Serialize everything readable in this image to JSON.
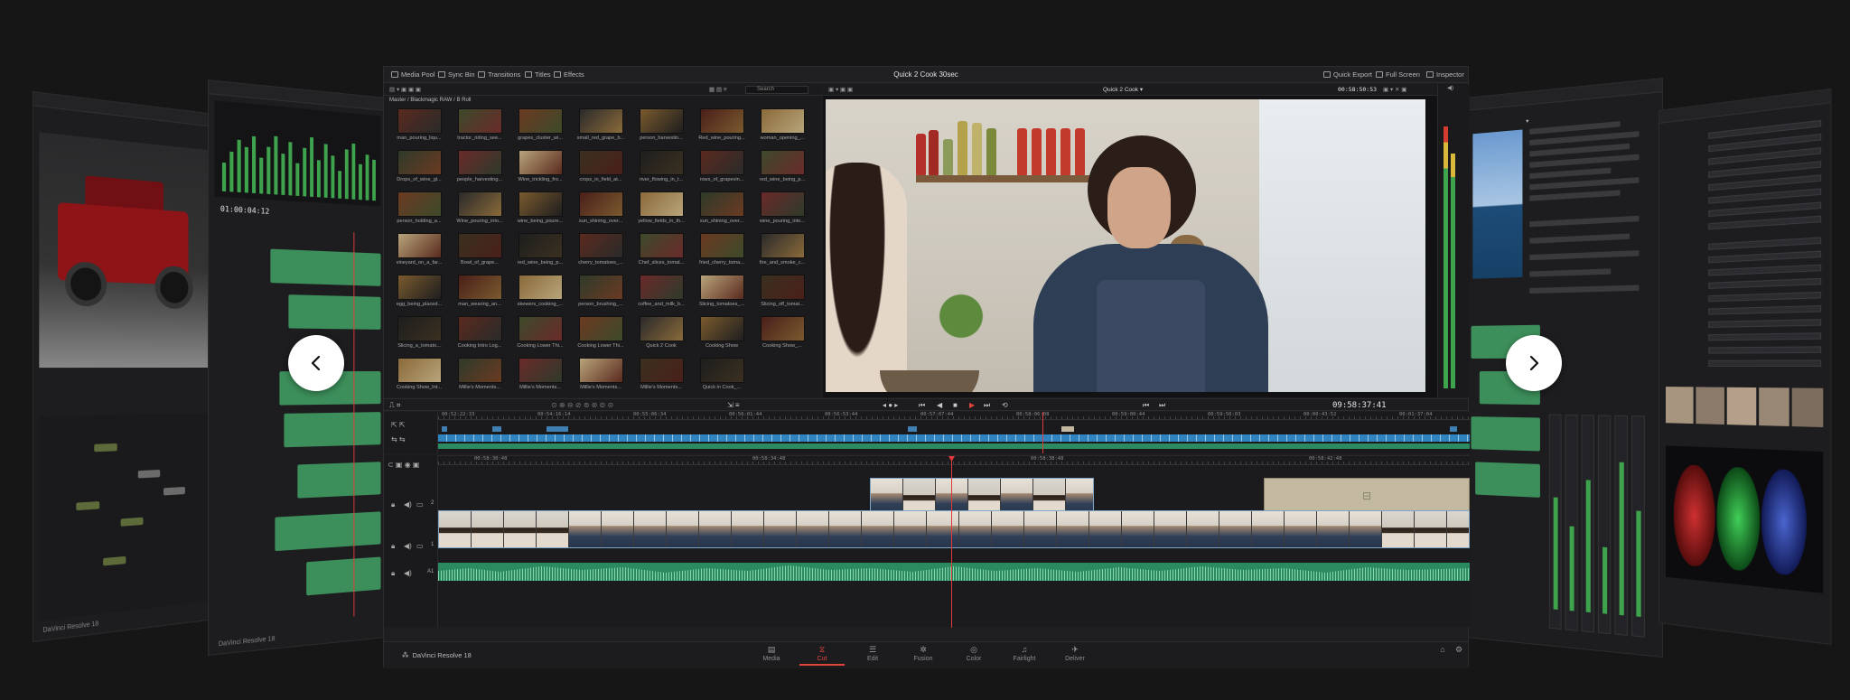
{
  "topbar": {
    "media_pool": "Media Pool",
    "sync_bin": "Sync Bin",
    "transitions": "Transitions",
    "titles": "Titles",
    "effects": "Effects",
    "window_title": "Quick 2 Cook 30sec",
    "quick_export": "Quick Export",
    "full_screen": "Full Screen",
    "inspector": "Inspector"
  },
  "media_pool": {
    "path": "Master / Blackmagic RAW / B Roll",
    "search_placeholder": "Search",
    "clips": [
      {
        "name": "man_pouring_liqu..."
      },
      {
        "name": "tractor_riding_see..."
      },
      {
        "name": "grapes_cluster_wi..."
      },
      {
        "name": "small_red_grape_b..."
      },
      {
        "name": "person_harvestin..."
      },
      {
        "name": "Red_wine_pouring..."
      },
      {
        "name": "woman_opening_..."
      },
      {
        "name": "Drops_of_wine_gl..."
      },
      {
        "name": "people_harvesting..."
      },
      {
        "name": "Wine_trickling_fro..."
      },
      {
        "name": "crops_in_field_at..."
      },
      {
        "name": "river_flowing_in_t..."
      },
      {
        "name": "rows_of_grapevin..."
      },
      {
        "name": "red_wine_being_p..."
      },
      {
        "name": "person_holding_a..."
      },
      {
        "name": "Wine_pouring_into..."
      },
      {
        "name": "wine_being_poure..."
      },
      {
        "name": "sun_shining_over..."
      },
      {
        "name": "yellow_fields_in_th..."
      },
      {
        "name": "sun_shining_over..."
      },
      {
        "name": "wine_pouring_into..."
      },
      {
        "name": "vineyard_on_a_far..."
      },
      {
        "name": "Bowl_of_grape..."
      },
      {
        "name": "red_wine_being_p..."
      },
      {
        "name": "cherry_tomatoes_..."
      },
      {
        "name": "Chef_slices_tomat..."
      },
      {
        "name": "fried_cherry_toma..."
      },
      {
        "name": "fire_and_smoke_c..."
      },
      {
        "name": "egg_being_placed..."
      },
      {
        "name": "man_wearing_an..."
      },
      {
        "name": "skewers_cooking_..."
      },
      {
        "name": "person_brushing_..."
      },
      {
        "name": "coffee_and_milk_b..."
      },
      {
        "name": "Slicing_tomatoes_..."
      },
      {
        "name": "Slicing_off_tomat..."
      },
      {
        "name": "Slicing_a_tomato..."
      },
      {
        "name": "Cooking Intro Log..."
      },
      {
        "name": "Cooking Lower Thi..."
      },
      {
        "name": "Cooking Lower Thi..."
      },
      {
        "name": "Quick 2 Cook"
      },
      {
        "name": "Cooking Show"
      },
      {
        "name": "Cooking Show_..."
      },
      {
        "name": "Cooking Show_Int..."
      },
      {
        "name": "Millie's Moments..."
      },
      {
        "name": "Millie's Moments..."
      },
      {
        "name": "Millie's Moments..."
      },
      {
        "name": "Millie's Moments..."
      },
      {
        "name": "Quick in Cook_..."
      }
    ]
  },
  "viewer": {
    "timeline_name": "Quick 2 Cook",
    "source_timecode": "00:58:50:53",
    "record_timecode": "09:58:37:41"
  },
  "upper_timeline": {
    "ruler": [
      "00:52:22:33",
      "00:54:16:14",
      "00:55:06:34",
      "00:56:01:44",
      "00:56:53:44",
      "00:57:07:44",
      "00:58:06:08",
      "00:59:00:44",
      "00:59:50:03",
      "00:00:43:52",
      "00:01:37:04"
    ]
  },
  "lower_timeline": {
    "ruler": [
      "00:58:30:48",
      "00:58:34:48",
      "00:58:38:48",
      "00:58:42:48"
    ],
    "track_v2": "2",
    "track_v1": "1",
    "track_a1": "A1"
  },
  "bottom_nav": {
    "brand": "DaVinci Resolve 18",
    "items": [
      {
        "label": "Media",
        "icon": "media-icon"
      },
      {
        "label": "Cut",
        "icon": "cut-icon",
        "active": true
      },
      {
        "label": "Edit",
        "icon": "edit-icon"
      },
      {
        "label": "Fusion",
        "icon": "fusion-icon"
      },
      {
        "label": "Color",
        "icon": "color-icon"
      },
      {
        "label": "Fairlight",
        "icon": "fairlight-icon"
      },
      {
        "label": "Deliver",
        "icon": "deliver-icon"
      }
    ]
  },
  "left_far_panel": {
    "brand": "DaVinci Resolve 18"
  },
  "left_near_panel": {
    "timecode": "01:00:04:12",
    "brand": "DaVinci Resolve 18"
  },
  "colors": {
    "accent_red": "#e3453b",
    "audio_green": "#2b8a5f",
    "clip_blue": "#7da6c8",
    "title_tan": "#c3b9a1"
  }
}
